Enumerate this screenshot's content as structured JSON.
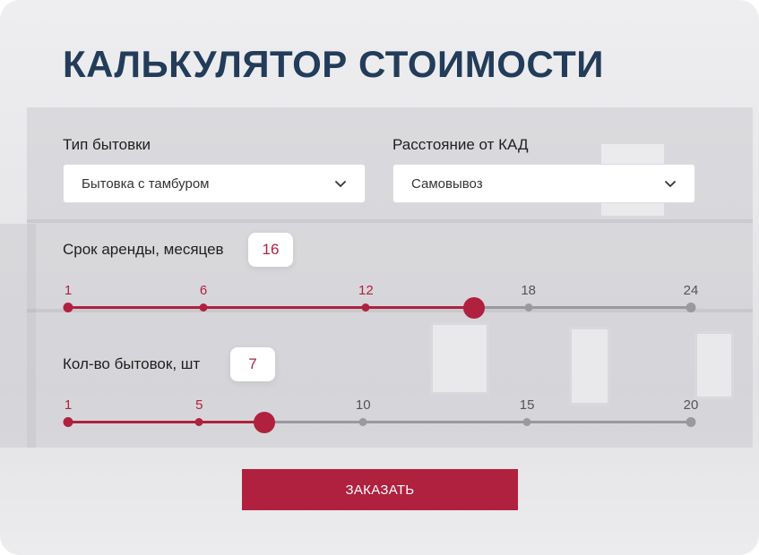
{
  "title": "КАЛЬКУЛЯТОР СТОИМОСТИ",
  "cabin_type": {
    "label": "Тип бытовки",
    "selected": "Бытовка с тамбуром"
  },
  "distance": {
    "label": "Расстояние от КАД",
    "selected": "Самовывоз"
  },
  "rent_term": {
    "label": "Срок аренды, месяцев",
    "value": "16",
    "min": 1,
    "max": 24,
    "current": 16,
    "ticks": [
      "1",
      "6",
      "12",
      "18",
      "24"
    ]
  },
  "cabin_count": {
    "label": "Кол-во бытовок, шт",
    "value": "7",
    "min": 1,
    "max": 20,
    "current": 7,
    "ticks": [
      "1",
      "5",
      "10",
      "15",
      "20"
    ]
  },
  "order_button": "ЗАКАЗАТЬ",
  "colors": {
    "accent": "#b0213f",
    "title": "#223c59",
    "track": "#9a9a9e"
  }
}
